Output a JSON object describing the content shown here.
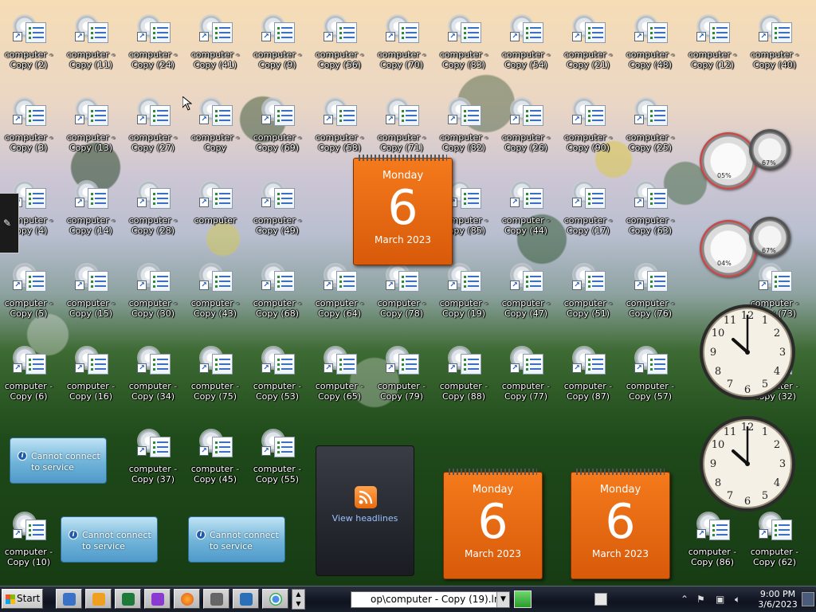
{
  "desktop": {
    "icons": [
      {
        "label": "computer -\nCopy (2)"
      },
      {
        "label": "computer -\nCopy (11)"
      },
      {
        "label": "computer -\nCopy (24)"
      },
      {
        "label": "computer -\nCopy (41)"
      },
      {
        "label": "computer -\nCopy (9)"
      },
      {
        "label": "computer -\nCopy (56)"
      },
      {
        "label": "computer -\nCopy (70)"
      },
      {
        "label": "computer -\nCopy (83)"
      },
      {
        "label": "computer -\nCopy (54)"
      },
      {
        "label": "computer -\nCopy (21)"
      },
      {
        "label": "computer -\nCopy (48)"
      },
      {
        "label": "computer -\nCopy (12)"
      },
      {
        "label": "computer -\nCopy (40)"
      },
      {
        "label": "computer -\nCopy (3)"
      },
      {
        "label": "computer -\nCopy (13)"
      },
      {
        "label": "computer -\nCopy (27)"
      },
      {
        "label": "computer -\nCopy"
      },
      {
        "label": "computer -\nCopy (69)"
      },
      {
        "label": "computer -\nCopy (58)"
      },
      {
        "label": "computer -\nCopy (71)"
      },
      {
        "label": "computer -\nCopy (82)"
      },
      {
        "label": "computer -\nCopy (26)"
      },
      {
        "label": "computer -\nCopy (90)"
      },
      {
        "label": "computer -\nCopy (25)"
      },
      {
        "label": "computer -\nCopy (4)"
      },
      {
        "label": "computer -\nCopy (14)"
      },
      {
        "label": "computer -\nCopy (28)"
      },
      {
        "label": "computer"
      },
      {
        "label": "computer -\nCopy (49)"
      },
      {
        "label": "computer -\nCopy (85)"
      },
      {
        "label": "computer -\nCopy (44)"
      },
      {
        "label": "computer -\nCopy (17)"
      },
      {
        "label": "computer -\nCopy (63)"
      },
      {
        "label": "computer -\nCopy (5)"
      },
      {
        "label": "computer -\nCopy (15)"
      },
      {
        "label": "computer -\nCopy (30)"
      },
      {
        "label": "computer -\nCopy (43)"
      },
      {
        "label": "computer -\nCopy (68)"
      },
      {
        "label": "computer -\nCopy (64)"
      },
      {
        "label": "computer -\nCopy (78)"
      },
      {
        "label": "computer -\nCopy (19)"
      },
      {
        "label": "computer -\nCopy (47)"
      },
      {
        "label": "computer -\nCopy (51)"
      },
      {
        "label": "computer -\nCopy (76)"
      },
      {
        "label": "computer -\nCopy (73)"
      },
      {
        "label": "computer -\nCopy (6)"
      },
      {
        "label": "computer -\nCopy (16)"
      },
      {
        "label": "computer -\nCopy (34)"
      },
      {
        "label": "computer -\nCopy (75)"
      },
      {
        "label": "computer -\nCopy (53)"
      },
      {
        "label": "computer -\nCopy (65)"
      },
      {
        "label": "computer -\nCopy (79)"
      },
      {
        "label": "computer -\nCopy (88)"
      },
      {
        "label": "computer -\nCopy (77)"
      },
      {
        "label": "computer -\nCopy (87)"
      },
      {
        "label": "computer -\nCopy (57)"
      },
      {
        "label": "computer -\nCopy (32)"
      },
      {
        "label": "computer -\nCopy (37)"
      },
      {
        "label": "computer -\nCopy (45)"
      },
      {
        "label": "computer -\nCopy (55)"
      },
      {
        "label": "computer -\nCopy (10)"
      },
      {
        "label": "computer -\nCopy (86)"
      },
      {
        "label": "computer -\nCopy (62)"
      }
    ]
  },
  "calendars": [
    {
      "day": "Monday",
      "date": "6",
      "month": "March 2023"
    },
    {
      "day": "Monday",
      "date": "6",
      "month": "March 2023"
    },
    {
      "day": "Monday",
      "date": "6",
      "month": "March 2023"
    }
  ],
  "notices": [
    {
      "text": "Cannot connect to service"
    },
    {
      "text": "Cannot connect to service"
    },
    {
      "text": "Cannot connect to service"
    }
  ],
  "feed": {
    "link": "View headlines"
  },
  "gauges": [
    {
      "cpu": "05%",
      "mem": "67%"
    },
    {
      "cpu": "04%",
      "mem": "67%"
    }
  ],
  "taskbar": {
    "start_label": "Start",
    "address_value": "op\\computer - Copy (19).lnk",
    "clock_time": "9:00 PM",
    "clock_date": "3/6/2023"
  },
  "colors": {
    "calendar": "#e8650f",
    "notice": "#6fb3d8",
    "feed": "#2a2d35"
  }
}
